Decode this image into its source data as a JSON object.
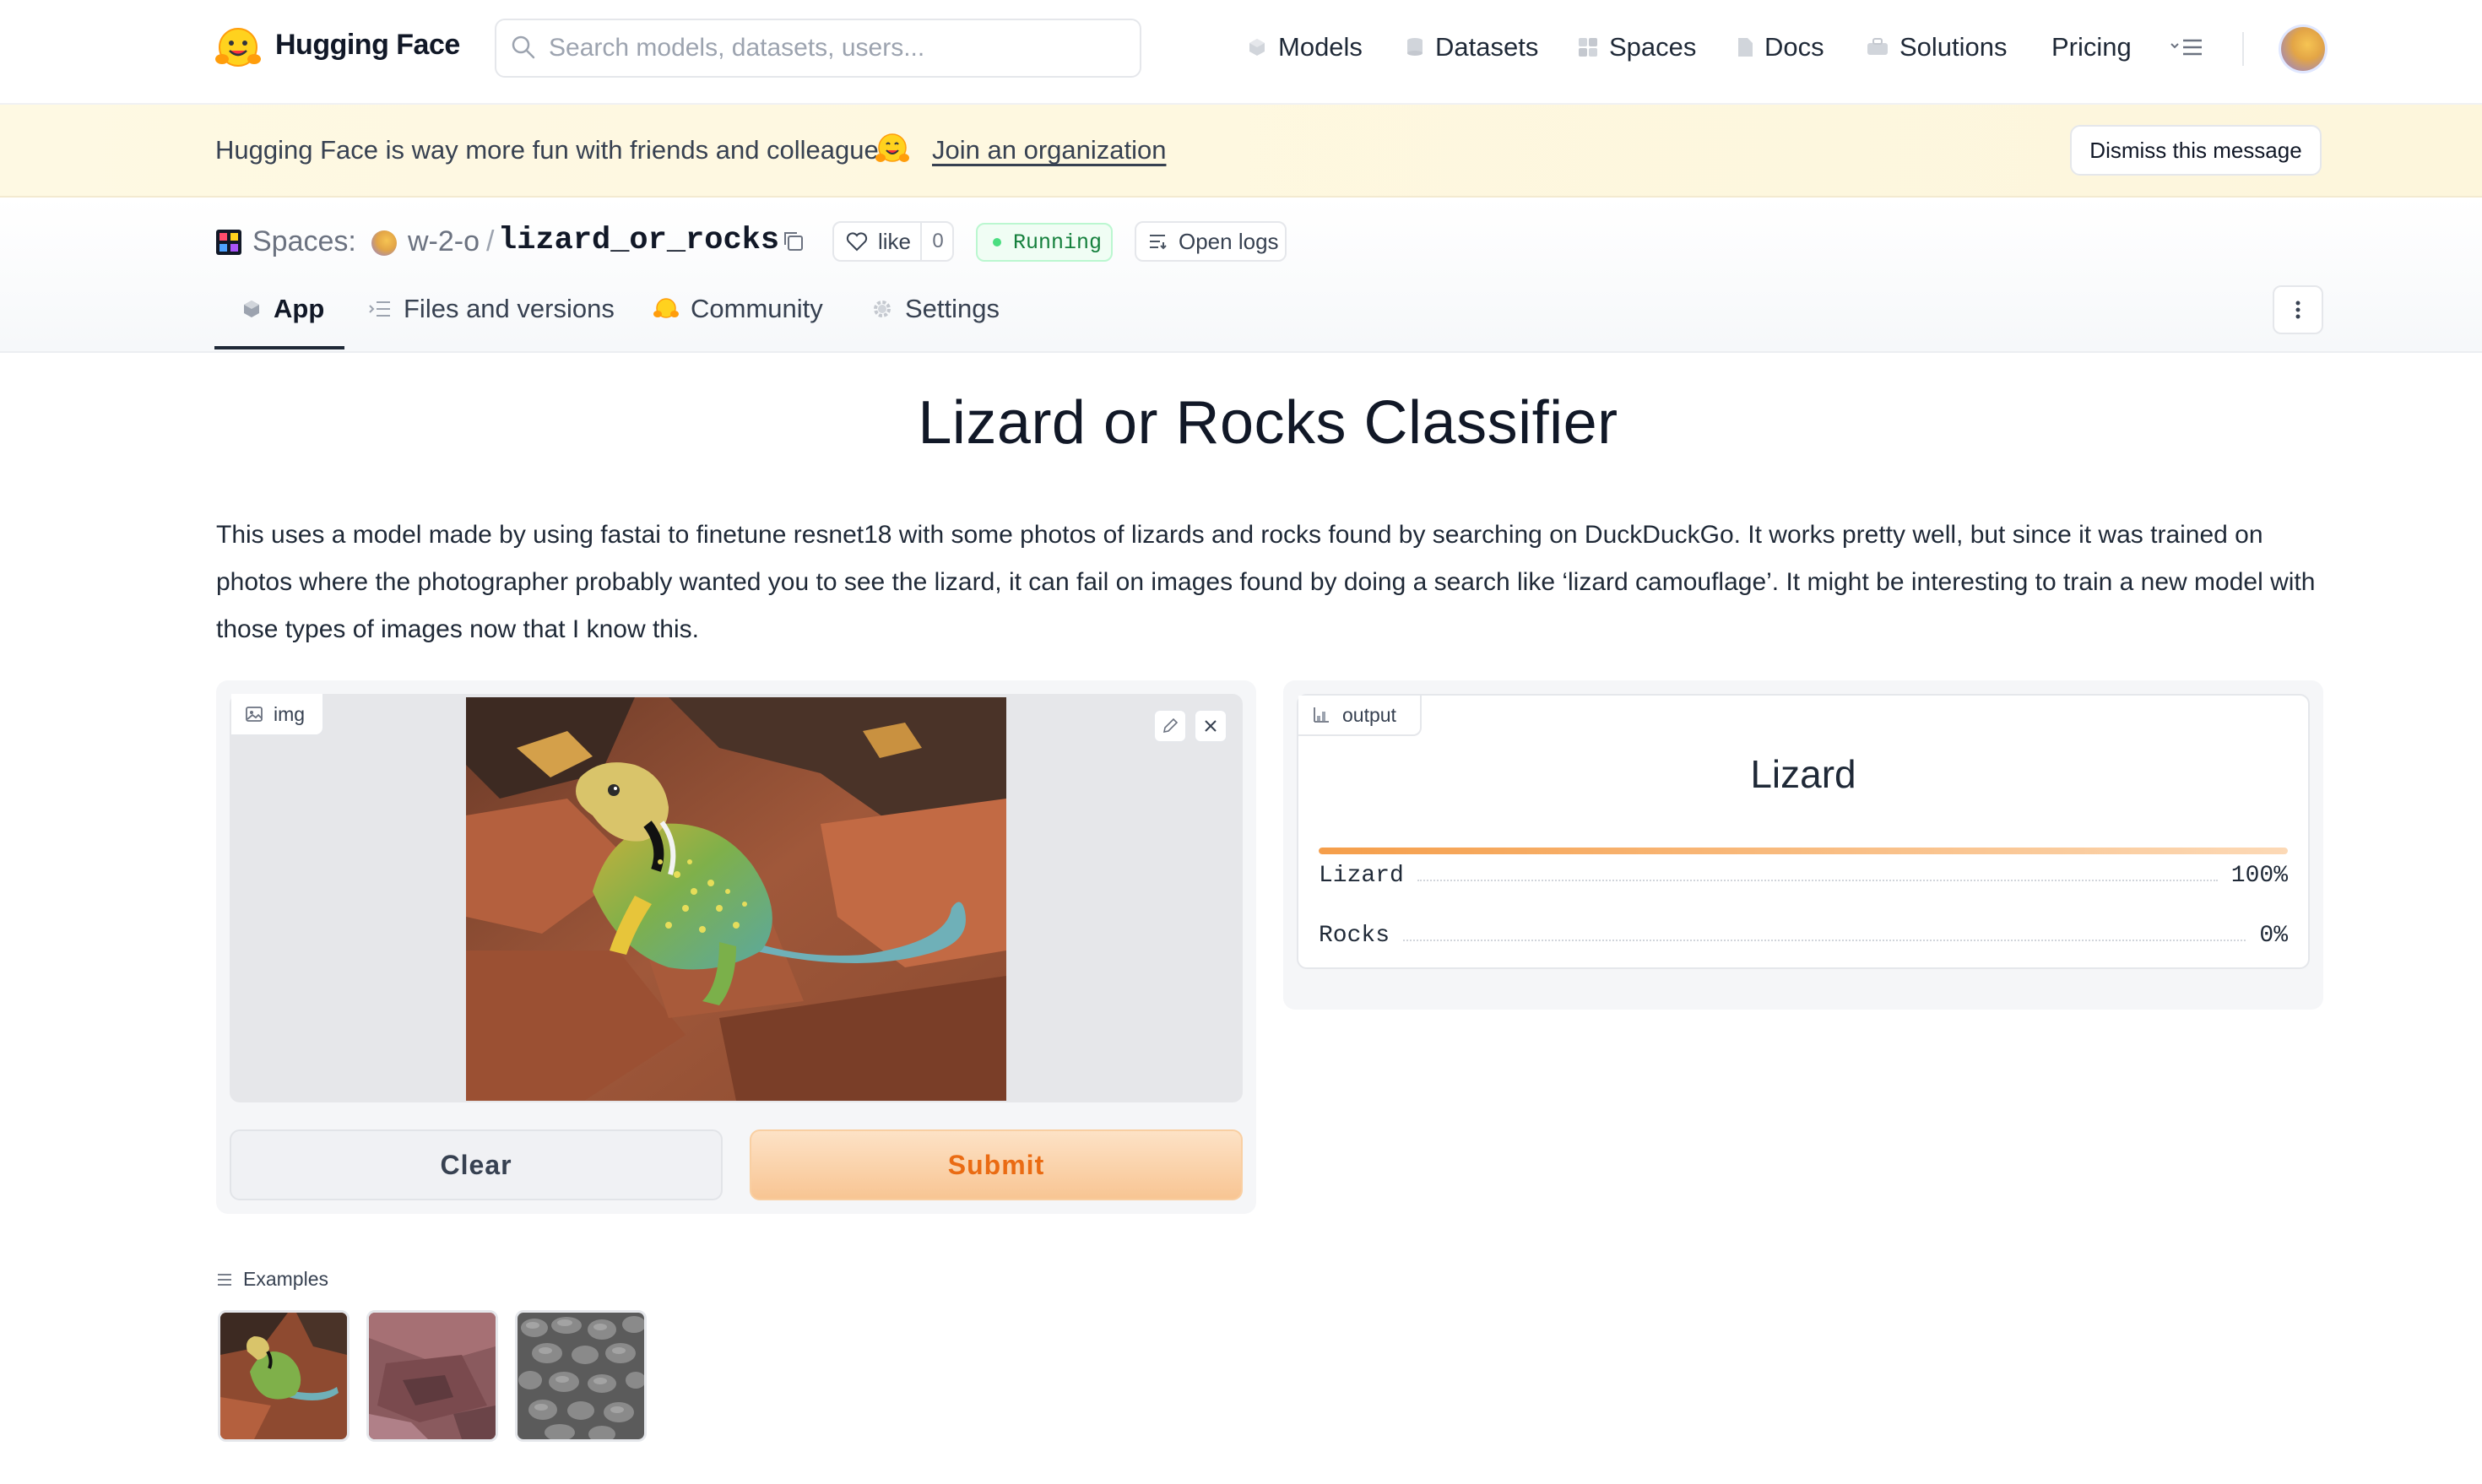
{
  "nav": {
    "brand": "Hugging Face",
    "search_placeholder": "Search models, datasets, users...",
    "items": [
      "Models",
      "Datasets",
      "Spaces",
      "Docs",
      "Solutions",
      "Pricing"
    ]
  },
  "banner": {
    "text": "Hugging Face is way more fun with friends and colleagues!",
    "link": "Join an organization",
    "dismiss": "Dismiss this message"
  },
  "space": {
    "section_label": "Spaces:",
    "owner": "w-2-o",
    "separator": "/",
    "repo": "lizard_or_rocks",
    "like_label": "like",
    "like_count": "0",
    "status": "Running",
    "logs_label": "Open logs",
    "tabs": [
      "App",
      "Files and versions",
      "Community",
      "Settings"
    ]
  },
  "app": {
    "title": "Lizard or Rocks Classifier",
    "description": "This uses a model made by using fastai to finetune resnet18 with some photos of lizards and rocks found by searching on DuckDuckGo. It works pretty well, but since it was trained on photos where the photographer probably wanted you to see the lizard, it can fail on images found by doing a search like ‘lizard camouflage’. It might be interesting to train a new model with those types of images now that I know this.",
    "input_label": "img",
    "clear": "Clear",
    "submit": "Submit",
    "output_label": "output",
    "prediction": "Lizard",
    "confidences": [
      {
        "label": "Lizard",
        "value": "100%",
        "fraction": 1.0
      },
      {
        "label": "Rocks",
        "value": "0%",
        "fraction": 0.0
      }
    ],
    "examples_label": "Examples"
  },
  "colors": {
    "accent": "#f59e4a",
    "submit_text": "#ea6b13",
    "status_green": "#15803d"
  }
}
